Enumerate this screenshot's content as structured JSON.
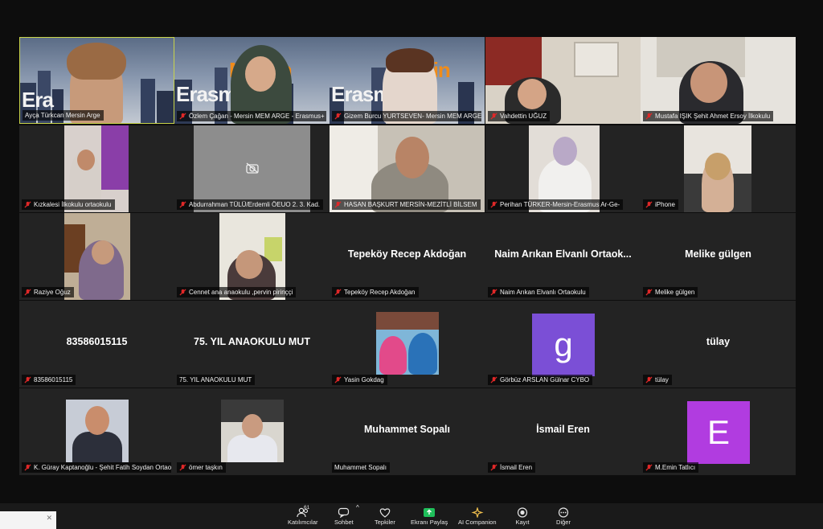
{
  "participants": [
    {
      "name": "Ayça Türkcan Mersin Arge",
      "type": "video"
    },
    {
      "name": "Özlem Çağan - Mersin MEM ARGE - Erasmus+",
      "type": "video"
    },
    {
      "name": "Gizem Burcu YURTSEVEN- Mersin MEM ARGE ERA...",
      "type": "video"
    },
    {
      "name": "Vahdettin UĞUZ",
      "type": "video"
    },
    {
      "name": "Mustafa IŞIK Şehit Ahmet Ersoy İlkokulu",
      "type": "video"
    },
    {
      "name": "Kızkalesi İlkokulu ortaokulu",
      "type": "video"
    },
    {
      "name": "Abdurrahman TÜLÜ/Erdemli ÖEUO 2. 3. Kad.",
      "type": "camoff"
    },
    {
      "name": "HASAN BAŞKURT MERSİN-MEZİTLİ BİLSEM",
      "type": "video"
    },
    {
      "name": "Perihan TÜRKER-Mersin-Erasmus Ar-Ge-",
      "type": "video"
    },
    {
      "name": "iPhone",
      "type": "video"
    },
    {
      "name": "Raziye Oğuz",
      "type": "video"
    },
    {
      "name": "Cennet ana anaokulu ,pervin pirinççi",
      "type": "video"
    },
    {
      "name": "Tepeköy Recep Akdoğan",
      "display": "Tepeköy Recep Akdoğan",
      "type": "name"
    },
    {
      "name": "Naim Arıkan Elvanlı Ortaokulu",
      "display": "Naim Arıkan Elvanlı Ortaok...",
      "type": "name"
    },
    {
      "name": "Melike gülgen",
      "display": "Melike gülgen",
      "type": "name"
    },
    {
      "name": "83586015115",
      "display": "83586015115",
      "type": "name"
    },
    {
      "name": "75. YIL ANAOKULU MUT",
      "display": "75. YIL ANAOKULU MUT",
      "type": "name"
    },
    {
      "name": "Yasin Gokdag",
      "type": "photo"
    },
    {
      "name": "Görbüz ARSLAN Gülnar CYBO",
      "letter": "g",
      "color": "#7b4fd6",
      "type": "letter"
    },
    {
      "name": "tülay",
      "display": "tülay",
      "type": "name"
    },
    {
      "name": "K. Güray Kaptanoğlu - Şehit Fatih Soydan Ortaokulu",
      "type": "photo"
    },
    {
      "name": "ömer taşkın",
      "type": "photo"
    },
    {
      "name": "Muhammet Sopalı",
      "display": "Muhammet Sopalı",
      "type": "name"
    },
    {
      "name": "İsmail Eren",
      "display": "İsmail Eren",
      "type": "name"
    },
    {
      "name": "M.Emin Tatlıcı",
      "letter": "E",
      "color": "#b13ce0",
      "type": "letter"
    }
  ],
  "toolbar": [
    {
      "label": "Katılımcılar",
      "icon": "participants-icon",
      "badge": "61"
    },
    {
      "label": "Sohbet",
      "icon": "chat-icon"
    },
    {
      "label": "Tepkiler",
      "icon": "heart-icon"
    },
    {
      "label": "Ekranı Paylaş",
      "icon": "share-screen-icon",
      "accent": "#1fbf5a"
    },
    {
      "label": "AI Companion",
      "icon": "ai-companion-icon",
      "accent": "#f2c14e"
    },
    {
      "label": "Kayıt",
      "icon": "record-icon"
    },
    {
      "label": "Diğer",
      "icon": "more-icon"
    }
  ],
  "colors": {
    "mute_red": "#e02828",
    "tile_bg": "#232323"
  }
}
